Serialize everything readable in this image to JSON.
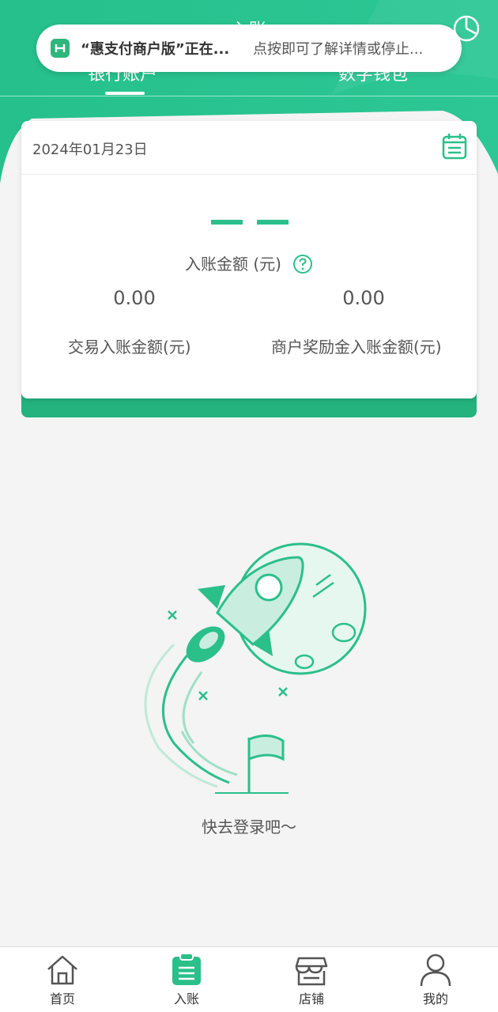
{
  "header": {
    "title": "入账",
    "tabs": [
      {
        "label": "银行账户",
        "active": true
      },
      {
        "label": "数字钱包",
        "active": false
      }
    ],
    "stats_icon": "pie-chart-icon"
  },
  "notification": {
    "app_icon": "huizhifu-app-icon",
    "title": "“惠支付商户版”正在...",
    "body": "点按即可了解详情或停止..."
  },
  "card": {
    "date": "2024年01月23日",
    "calendar_icon": "calendar-icon",
    "total_value": "— —",
    "total_label": "入账金额 (元)",
    "help_icon": "question-icon",
    "trade_value": "0.00",
    "trade_label": "交易入账金额(元)",
    "reward_value": "0.00",
    "reward_label": "商户奖励金入账金额(元)"
  },
  "empty_state": {
    "illustration": "rocket-moon-illustration",
    "text": "快去登录吧～"
  },
  "bottom_nav": {
    "items": [
      {
        "label": "首页",
        "icon": "home-icon",
        "active": false
      },
      {
        "label": "入账",
        "icon": "clipboard-icon",
        "active": true
      },
      {
        "label": "店铺",
        "icon": "store-icon",
        "active": false
      },
      {
        "label": "我的",
        "icon": "user-icon",
        "active": false
      }
    ]
  },
  "colors": {
    "brand_green": "#2bbf8a",
    "header_green": "#27c28c",
    "text_gray": "#555555",
    "page_bg": "#f4f4f4"
  }
}
